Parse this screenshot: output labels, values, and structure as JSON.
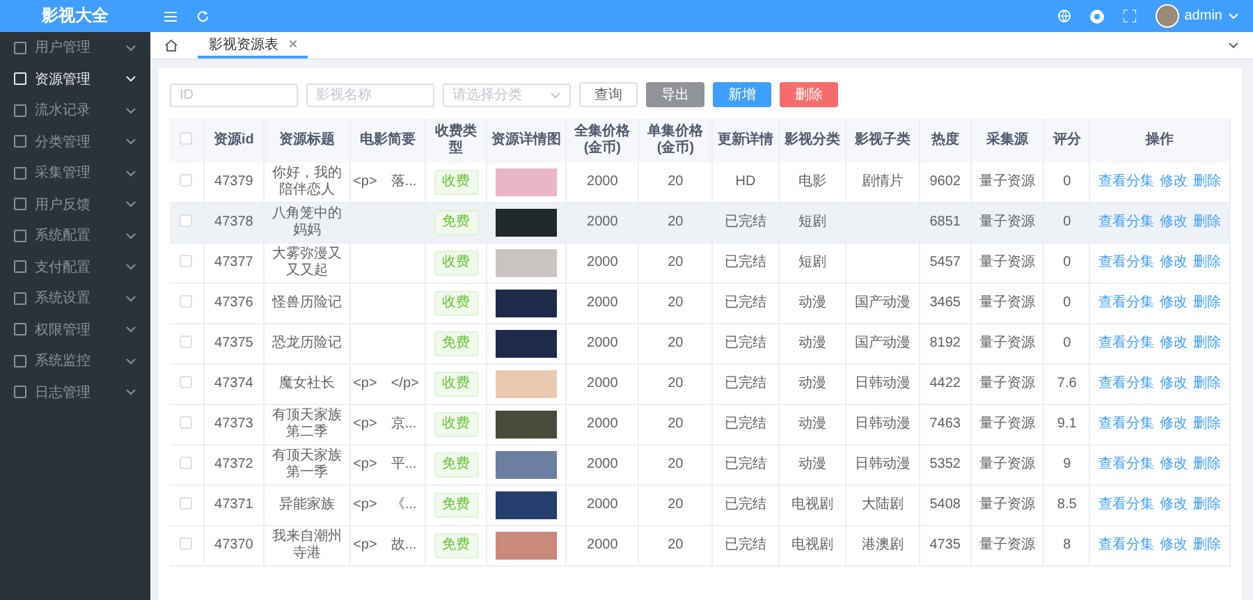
{
  "app_title": "影视大全",
  "sidebar": {
    "items": [
      {
        "label": "用户管理",
        "selected": false
      },
      {
        "label": "资源管理",
        "selected": true
      },
      {
        "label": "流水记录",
        "selected": false
      },
      {
        "label": "分类管理",
        "selected": false
      },
      {
        "label": "采集管理",
        "selected": false
      },
      {
        "label": "用户反馈",
        "selected": false
      },
      {
        "label": "系统配置",
        "selected": false
      },
      {
        "label": "支付配置",
        "selected": false
      },
      {
        "label": "系统设置",
        "selected": false
      },
      {
        "label": "权限管理",
        "selected": false
      },
      {
        "label": "系统监控",
        "selected": false
      },
      {
        "label": "日志管理",
        "selected": false
      }
    ]
  },
  "header": {
    "user": "admin"
  },
  "tabs": [
    {
      "label": "影视资源表",
      "selected": true
    }
  ],
  "filters": {
    "id_placeholder": "ID",
    "name_placeholder": "影视名称",
    "category_placeholder": "请选择分类"
  },
  "buttons": [
    {
      "label": "查询",
      "kind": "plain"
    },
    {
      "label": "导出",
      "kind": "info"
    },
    {
      "label": "新增",
      "kind": "primary"
    },
    {
      "label": "删除",
      "kind": "danger"
    }
  ],
  "table": {
    "select_all_checked": false,
    "columns": [
      "资源id",
      "资源标题",
      "电影简要",
      "收费类型",
      "资源详情图",
      "全集价格(金币)",
      "单集价格(金币)",
      "更新详情",
      "影视分类",
      "影视子类",
      "热度",
      "采集源",
      "评分",
      "操作"
    ],
    "rows": [
      {
        "id": "47379",
        "title": "你好，我的陪伴恋人",
        "brief": "<p>　落...",
        "fee": "收费",
        "full_price": "2000",
        "unit_price": "20",
        "update": "HD",
        "category": "电影",
        "subcategory": "剧情片",
        "heat": "9602",
        "source": "量子资源",
        "score": "0",
        "actions": [
          "查看分集",
          "修改",
          "删除"
        ],
        "highlighted": false,
        "checked": false,
        "color": "#e7b7c6"
      },
      {
        "id": "47378",
        "title": "八角笼中的妈妈",
        "brief": "",
        "fee": "免费",
        "full_price": "2000",
        "unit_price": "20",
        "update": "已完结",
        "category": "短剧",
        "subcategory": "",
        "heat": "6851",
        "source": "量子资源",
        "score": "0",
        "actions": [
          "查看分集",
          "修改",
          "删除"
        ],
        "highlighted": true,
        "checked": false,
        "color": "#1f2a2c"
      },
      {
        "id": "47377",
        "title": "大雾弥漫又又又起",
        "brief": "",
        "fee": "收费",
        "full_price": "2000",
        "unit_price": "20",
        "update": "已完结",
        "category": "短剧",
        "subcategory": "",
        "heat": "5457",
        "source": "量子资源",
        "score": "0",
        "actions": [
          "查看分集",
          "修改",
          "删除"
        ],
        "highlighted": false,
        "checked": false,
        "color": "#c9c4c2"
      },
      {
        "id": "47376",
        "title": "怪兽历险记",
        "brief": "",
        "fee": "收费",
        "full_price": "2000",
        "unit_price": "20",
        "update": "已完结",
        "category": "动漫",
        "subcategory": "国产动漫",
        "heat": "3465",
        "source": "量子资源",
        "score": "0",
        "actions": [
          "查看分集",
          "修改",
          "删除"
        ],
        "highlighted": false,
        "checked": false,
        "color": "#1d2a4a"
      },
      {
        "id": "47375",
        "title": "恐龙历险记",
        "brief": "",
        "fee": "免费",
        "full_price": "2000",
        "unit_price": "20",
        "update": "已完结",
        "category": "动漫",
        "subcategory": "国产动漫",
        "heat": "8192",
        "source": "量子资源",
        "score": "0",
        "actions": [
          "查看分集",
          "修改",
          "删除"
        ],
        "highlighted": false,
        "checked": false,
        "color": "#1d2a4a"
      },
      {
        "id": "47374",
        "title": "魔女社长",
        "brief": "<p>　</p>",
        "fee": "收费",
        "full_price": "2000",
        "unit_price": "20",
        "update": "已完结",
        "category": "动漫",
        "subcategory": "日韩动漫",
        "heat": "4422",
        "source": "量子资源",
        "score": "7.6",
        "actions": [
          "查看分集",
          "修改",
          "删除"
        ],
        "highlighted": false,
        "checked": false,
        "color": "#e9c9b0"
      },
      {
        "id": "47373",
        "title": "有顶天家族第二季",
        "brief": "<p>　京...",
        "fee": "收费",
        "full_price": "2000",
        "unit_price": "20",
        "update": "已完结",
        "category": "动漫",
        "subcategory": "日韩动漫",
        "heat": "7463",
        "source": "量子资源",
        "score": "9.1",
        "actions": [
          "查看分集",
          "修改",
          "删除"
        ],
        "highlighted": false,
        "checked": false,
        "color": "#4a4a3a"
      },
      {
        "id": "47372",
        "title": "有顶天家族第一季",
        "brief": "<p>　平...",
        "fee": "免费",
        "full_price": "2000",
        "unit_price": "20",
        "update": "已完结",
        "category": "动漫",
        "subcategory": "日韩动漫",
        "heat": "5352",
        "source": "量子资源",
        "score": "9",
        "actions": [
          "查看分集",
          "修改",
          "删除"
        ],
        "highlighted": false,
        "checked": false,
        "color": "#6d7fa0"
      },
      {
        "id": "47371",
        "title": "异能家族",
        "brief": "<p>　《...",
        "fee": "免费",
        "full_price": "2000",
        "unit_price": "20",
        "update": "已完结",
        "category": "电视剧",
        "subcategory": "大陆剧",
        "heat": "5408",
        "source": "量子资源",
        "score": "8.5",
        "actions": [
          "查看分集",
          "修改",
          "删除"
        ],
        "highlighted": false,
        "checked": false,
        "color": "#243f6e"
      },
      {
        "id": "47370",
        "title": "我来自潮州寺港",
        "brief": "<p>　故...",
        "fee": "免费",
        "full_price": "2000",
        "unit_price": "20",
        "update": "已完结",
        "category": "电视剧",
        "subcategory": "港澳剧",
        "heat": "4735",
        "source": "量子资源",
        "score": "8",
        "actions": [
          "查看分集",
          "修改",
          "删除"
        ],
        "highlighted": false,
        "checked": false,
        "color": "#c98a7c"
      }
    ]
  }
}
